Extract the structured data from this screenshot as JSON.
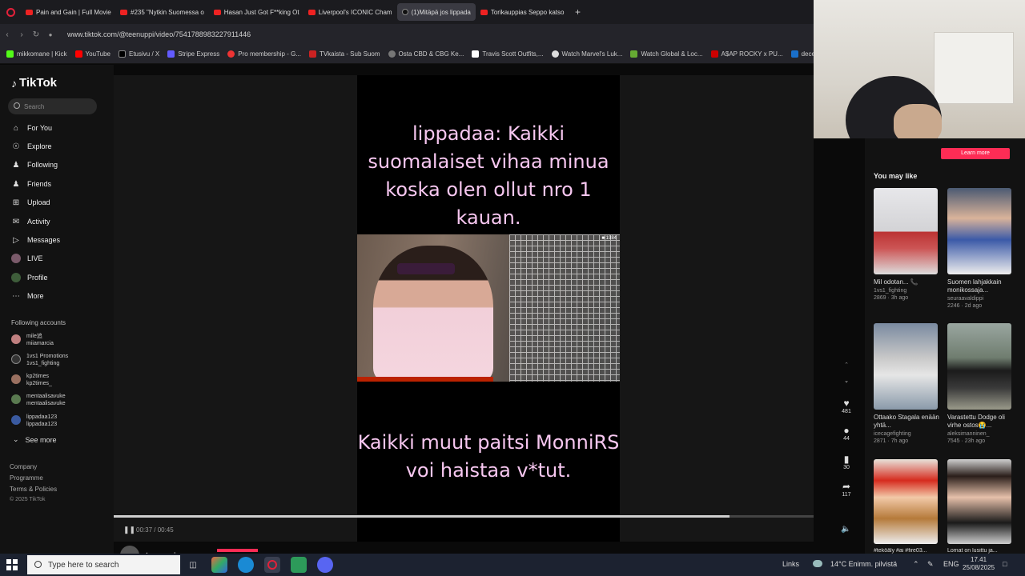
{
  "browser": {
    "tabs": [
      {
        "label": "Pain and Gain | Full Movie",
        "active": false
      },
      {
        "label": "#235 \"Nytkin Suomessa o",
        "active": false
      },
      {
        "label": "Hasan Just Got F**king Ot",
        "active": false
      },
      {
        "label": "Liverpool's ICONIC Cham",
        "active": false
      },
      {
        "label": "(1)Mitäpä jos lippada",
        "active": true
      },
      {
        "label": "Torikauppias Seppo katso",
        "active": false
      }
    ],
    "new_tab": "+",
    "url": "www.tiktok.com/@teenuppi/video/7541788983227911446",
    "bookmarks": [
      "mikkomane | Kick",
      "YouTube",
      "Etusivu / X",
      "Stripe Express",
      "Pro membership - G...",
      "TVkaista - Sub Suom",
      "Osta CBD & CBG Ke...",
      "Travis Scott Outfits,...",
      "Watch Marvel's Luk...",
      "Watch Global & Loc...",
      "A$AP ROCKY x PU...",
      "deceived"
    ]
  },
  "tiktok": {
    "logo": "TikTok",
    "search_placeholder": "Search",
    "nav": [
      {
        "label": "For You",
        "icon": "home-icon"
      },
      {
        "label": "Explore",
        "icon": "compass-icon"
      },
      {
        "label": "Following",
        "icon": "following-icon"
      },
      {
        "label": "Friends",
        "icon": "friends-icon"
      },
      {
        "label": "Upload",
        "icon": "upload-icon"
      },
      {
        "label": "Activity",
        "icon": "bell-icon"
      },
      {
        "label": "Messages",
        "icon": "messages-icon"
      },
      {
        "label": "LIVE",
        "icon": "live-icon"
      },
      {
        "label": "Profile",
        "icon": "profile-icon"
      },
      {
        "label": "More",
        "icon": "more-icon"
      }
    ],
    "following_title": "Following accounts",
    "following": [
      {
        "name": "mile追",
        "handle": "miiamarcia",
        "color": "#c08080"
      },
      {
        "name": "1vs1 Promotions",
        "handle": "1vs1_fighting",
        "color": "#333333"
      },
      {
        "name": "kp2times",
        "handle": "kp2times_",
        "color": "#9a7060"
      },
      {
        "name": "mentaalisavuke",
        "handle": "mentaalisavuke",
        "color": "#5a7a50"
      },
      {
        "name": "lippadaa123",
        "handle": "lippadaa123",
        "color": "#3a5aa0"
      }
    ],
    "see_more": "See more",
    "footer": [
      "Company",
      "Programme",
      "Terms & Policies",
      "© 2025 TikTok"
    ],
    "video": {
      "caption_top": "lippadaa: Kaikki suomalaiset vihaa minua koska olen ollut nro 1 kauan.",
      "caption_bottom": "Kaikki muut paitsi MonniRS voi haistaa v*tut.",
      "viewer_count": "1984",
      "time": "00:37 / 00:45",
      "progress": 0.88,
      "author": "teenuppi"
    },
    "actions": [
      {
        "icon": "heart-icon",
        "count": "481"
      },
      {
        "icon": "comment-icon",
        "count": "44"
      },
      {
        "icon": "bookmark-icon",
        "count": "30"
      },
      {
        "icon": "share-icon",
        "count": "117"
      }
    ],
    "right_panel": {
      "learn_more": "Learn more",
      "you_may_like": "You may like",
      "items": [
        {
          "title": "Mil odotan... 📞",
          "handle": "1vs1_fighting",
          "meta": "2869 · 3h ago"
        },
        {
          "title": "Suomen lahjakkain monikossaja...",
          "handle": "seuraavaldippi",
          "meta": "2246 · 2d ago"
        },
        {
          "title": "Ottaako Stagala enään yhtä...",
          "handle": "icecagefighting",
          "meta": "2871 · 7h ago"
        },
        {
          "title": "Varastettu Dodge oli virhe ostos😭...",
          "handle": "aleksimanninen_",
          "meta": "7545 · 23h ago"
        },
        {
          "title": "#teköäly #ai #fire03...",
          "handle": "",
          "meta": ""
        },
        {
          "title": "Lomat on lusittu ja...",
          "handle": "",
          "meta": ""
        }
      ]
    }
  },
  "taskbar": {
    "search_placeholder": "Type here to search",
    "links": "Links",
    "weather": "14°C  Enimm. pilvistä",
    "lang": "ENG",
    "time": "17.41",
    "date": "25/08/2025"
  }
}
